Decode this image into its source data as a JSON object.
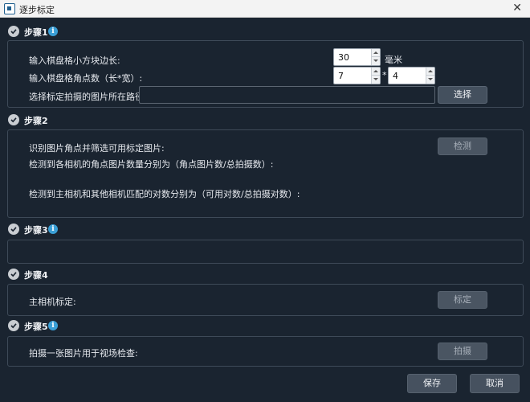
{
  "window": {
    "title": "逐步标定",
    "close_glyph": "✕"
  },
  "steps": [
    {
      "label": "步骤1",
      "has_info": true
    },
    {
      "label": "步骤2",
      "has_info": false
    },
    {
      "label": "步骤3",
      "has_info": true
    },
    {
      "label": "步骤4",
      "has_info": false
    },
    {
      "label": "步骤5",
      "has_info": true
    }
  ],
  "info_glyph": "i",
  "step1": {
    "square_size_label": "输入棋盘格小方块边长:",
    "square_size_value": "30",
    "square_size_unit": "毫米",
    "corners_label": "输入棋盘格角点数（长*宽）:",
    "corners_length": "7",
    "corners_separator": "*",
    "corners_width": "4",
    "path_label": "选择标定拍摄的图片所在路径:",
    "path_value": "",
    "select_button": "选择"
  },
  "step2": {
    "detect_label": "识别图片角点并筛选可用标定图片:",
    "detect_button": "检测",
    "count_label": "检测到各相机的角点图片数量分别为（角点图片数/总拍摄数）:",
    "pair_label": "检测到主相机和其他相机匹配的对数分别为（可用对数/总拍摄对数）:"
  },
  "step4": {
    "main_cam_label": "主相机标定:",
    "calibrate_button": "标定"
  },
  "step5": {
    "capture_label": "拍摄一张图片用于视场检查:",
    "capture_button": "拍摄"
  },
  "footer": {
    "save_button": "保存",
    "cancel_button": "取消"
  },
  "colors": {
    "background": "#1a2430",
    "panel_border": "#3e4a58",
    "info_blue": "#3a9fd6",
    "button_active": "#44505e",
    "button_disabled": "#4a5562"
  }
}
